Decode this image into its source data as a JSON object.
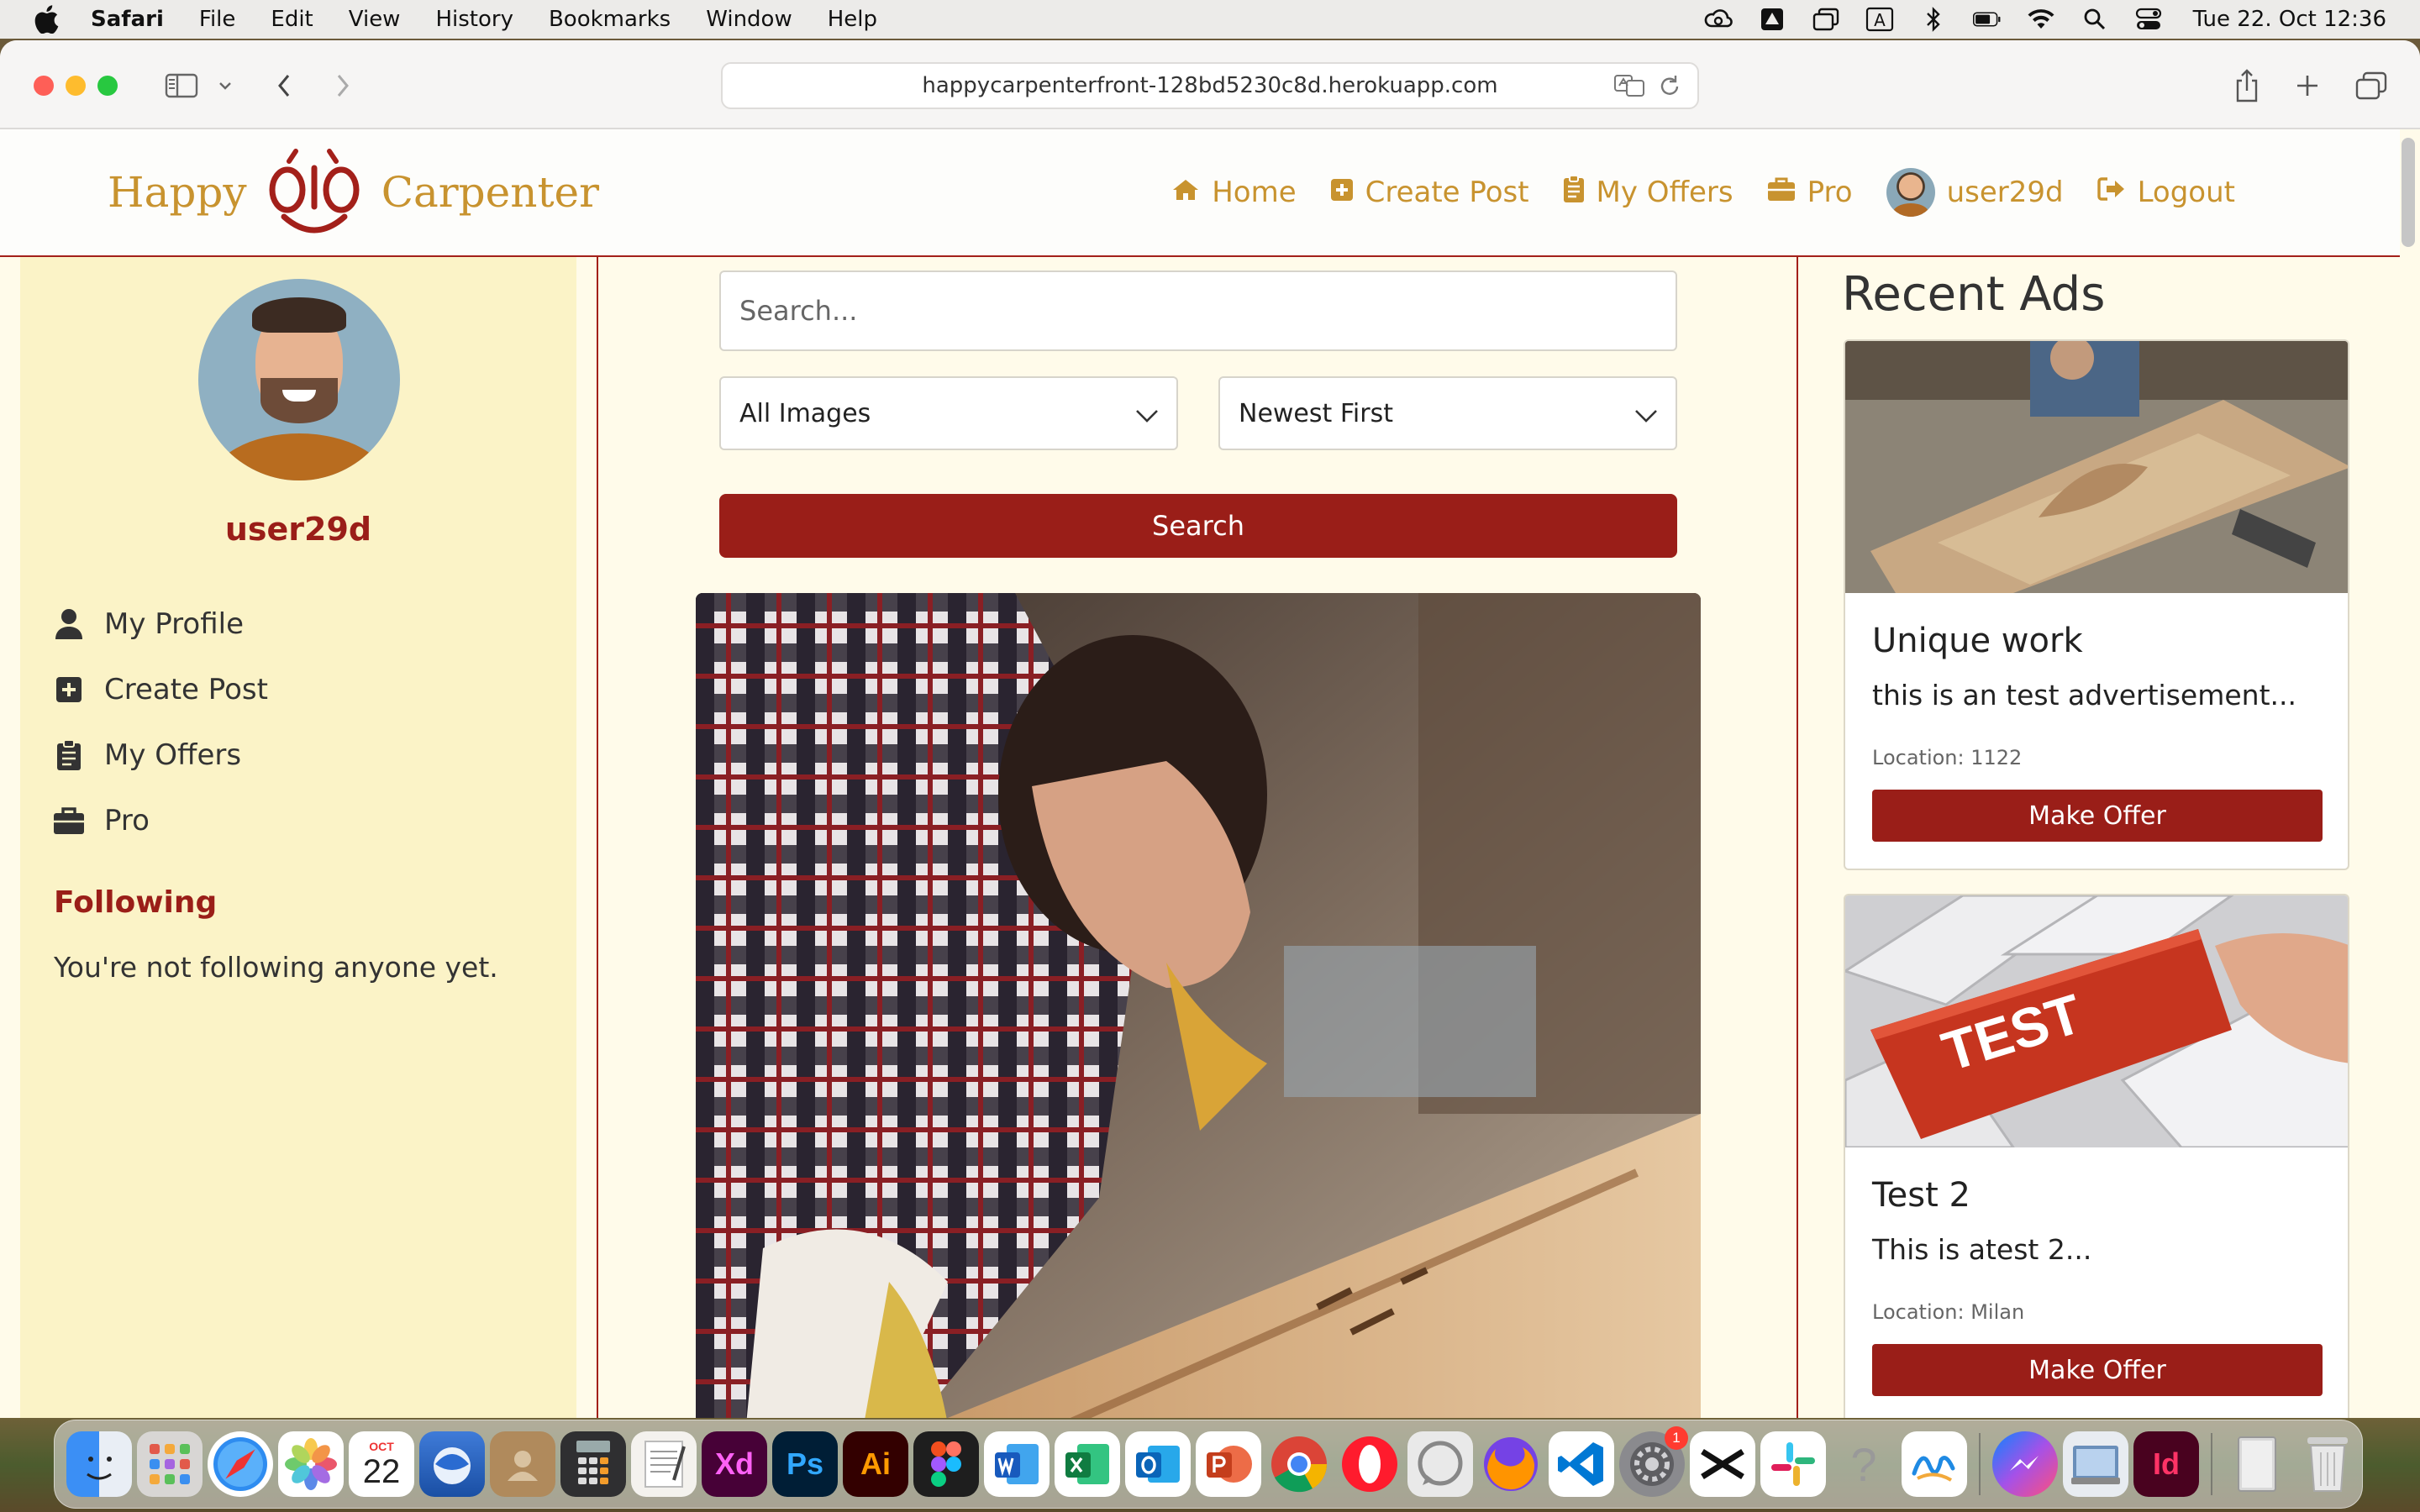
{
  "menubar": {
    "app": "Safari",
    "items": [
      "File",
      "Edit",
      "View",
      "History",
      "Bookmarks",
      "Window",
      "Help"
    ],
    "clock": "Tue 22. Oct  12:36",
    "status_icons": [
      "creative-cloud-icon",
      "drive-icon",
      "screen-icon",
      "input-a-icon",
      "bluetooth-icon",
      "battery-icon",
      "wifi-icon",
      "search-icon",
      "control-center-icon"
    ],
    "input_letter": "A"
  },
  "browser": {
    "url": "happycarpenterfront-128bd5230c8d.herokuapp.com"
  },
  "nav": {
    "logo_left": "Happy",
    "logo_right": "Carpenter",
    "links": {
      "home": "Home",
      "create_post": "Create Post",
      "my_offers": "My Offers",
      "pro": "Pro",
      "user": "user29d",
      "logout": "Logout"
    }
  },
  "sidebar": {
    "username": "user29d",
    "items": [
      {
        "label": "My Profile",
        "icon": "user-icon"
      },
      {
        "label": "Create Post",
        "icon": "plus-square-icon"
      },
      {
        "label": "My Offers",
        "icon": "clipboard-icon"
      },
      {
        "label": "Pro",
        "icon": "briefcase-icon"
      }
    ],
    "following_title": "Following",
    "following_text": "You're not following anyone yet."
  },
  "feed": {
    "search_placeholder": "Search...",
    "filter_selected": "All Images",
    "sort_selected": "Newest First",
    "search_button": "Search"
  },
  "recent_ads": {
    "title": "Recent Ads",
    "ads": [
      {
        "title": "Unique work",
        "description": "this is an test advertisement...",
        "location": "Location: 1122",
        "button": "Make Offer"
      },
      {
        "title": "Test 2",
        "description": "This is atest 2...",
        "location": "Location: Milan",
        "button": "Make Offer",
        "image_text": "TEST"
      }
    ]
  },
  "dock": {
    "calendar_month": "OCT",
    "calendar_day": "22",
    "xd": "Xd",
    "ps": "Ps",
    "ai": "Ai",
    "id": "Id",
    "settings_badge": "1",
    "help": "?"
  },
  "colors": {
    "brand_red": "#9a1e18",
    "brand_gold": "#c8932f",
    "page_bg": "#fffbea",
    "sidebar_bg": "#fbf3c7"
  }
}
